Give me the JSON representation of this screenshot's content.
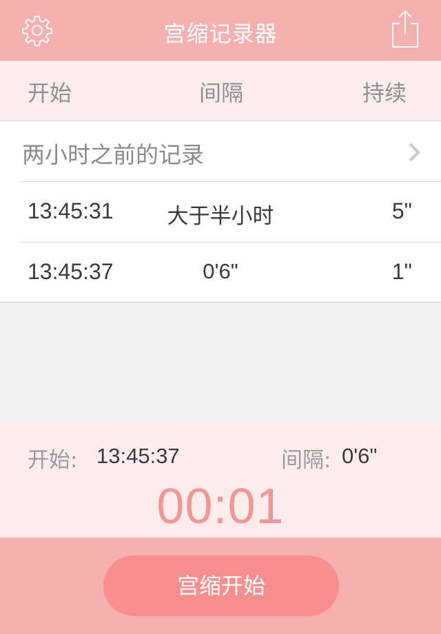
{
  "header": {
    "title": "宫缩记录器",
    "settings_icon": "gear-icon",
    "share_icon": "share-icon"
  },
  "columns": {
    "start": "开始",
    "interval": "间隔",
    "duration": "持续"
  },
  "history": {
    "older_label": "两小时之前的记录",
    "chevron_icon": "chevron-right-icon"
  },
  "records": [
    {
      "time": "13:45:31",
      "interval": "大于半小时",
      "duration": "5\""
    },
    {
      "time": "13:45:37",
      "interval": "0'6\"",
      "duration": "1\""
    }
  ],
  "current": {
    "start_label": "开始:",
    "start_value": "13:45:37",
    "interval_label": "间隔:",
    "interval_value": "0'6\"",
    "timer": "00:01"
  },
  "footer": {
    "start_button_label": "宫缩开始"
  },
  "colors": {
    "bar": "#f6b0b0",
    "light_bg": "#fdecec",
    "button": "#f88e8e",
    "timer": "#f29696"
  }
}
